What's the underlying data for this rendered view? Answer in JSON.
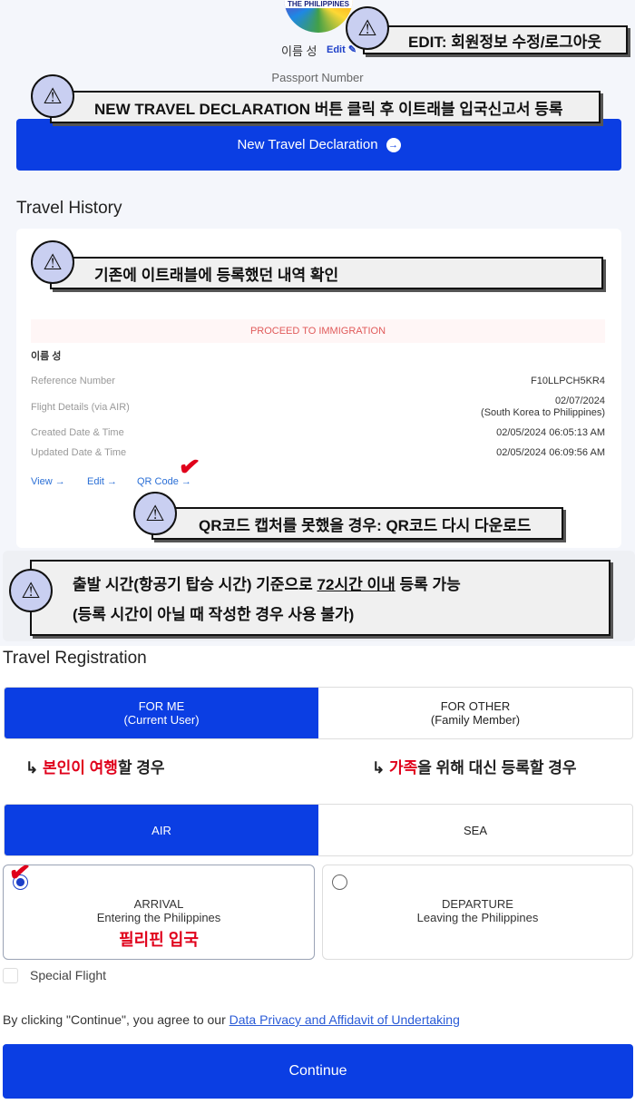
{
  "profile": {
    "logo_text": "THE PHILIPPINES",
    "name": "이름 성",
    "edit_label": "Edit",
    "passport_label": "Passport Number"
  },
  "new_declaration": {
    "label": "New Travel Declaration"
  },
  "travel_history": {
    "title": "Travel History",
    "status": "PROCEED TO IMMIGRATION",
    "name": "이름 성",
    "rows": [
      {
        "label": "Reference Number",
        "value": "F10LLPCH5KR4"
      },
      {
        "label": "Flight Details (via AIR)",
        "value": "02/07/2024",
        "value2": "(South Korea to Philippines)"
      },
      {
        "label": "Created Date & Time",
        "value": "02/05/2024 06:05:13 AM"
      },
      {
        "label": "Updated Date & Time",
        "value": "02/05/2024 06:09:56 AM"
      }
    ],
    "actions": [
      "View",
      "Edit",
      "QR Code"
    ]
  },
  "callouts": {
    "edit": "EDIT: 회원정보 수정/로그아웃",
    "new": "NEW TRAVEL DECLARATION 버튼 클릭 후 이트래블 입국신고서 등록",
    "history": "기존에 이트래블에 등록했던 내역 확인",
    "qr": "QR코드 캡처를 못했을 경우: QR코드 다시 다운로드",
    "time_line1_a": "출발 시간(항공기 탑승 시간) 기준으로 ",
    "time_line1_b": "72시간 이내",
    "time_line1_c": " 등록 가능",
    "time_line2": "(등록 시간이 아닐 때 작성한 경우 사용 불가)",
    "note_me_red": "본인이 여행",
    "note_me_rest": "할 경우",
    "note_other_red": "가족",
    "note_other_rest": "을 위해 대신 등록할 경우",
    "arrival_ko": "필리핀 입국"
  },
  "registration": {
    "title": "Travel Registration",
    "for_me": {
      "line1": "FOR ME",
      "line2": "(Current User)",
      "selected": true
    },
    "for_other": {
      "line1": "FOR OTHER",
      "line2": "(Family Member)",
      "selected": false
    },
    "mode": {
      "air": "AIR",
      "sea": "SEA",
      "selected": "AIR"
    },
    "arrival": {
      "line1": "ARRIVAL",
      "line2": "Entering the Philippines",
      "selected": true
    },
    "departure": {
      "line1": "DEPARTURE",
      "line2": "Leaving the Philippines",
      "selected": false
    },
    "special_flight": {
      "label": "Special Flight",
      "checked": false
    },
    "agree_text": "By clicking \"Continue\", you agree to our ",
    "agree_link": "Data Privacy and Affidavit of Undertaking",
    "continue_label": "Continue"
  },
  "colors": {
    "primary": "#0b3ee3",
    "annotation_red": "#e0001b"
  }
}
